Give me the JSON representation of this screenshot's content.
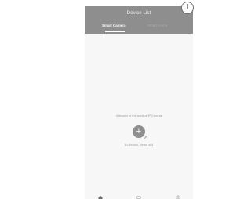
{
  "header": {
    "title": "Device List",
    "tabs": [
      {
        "label": "Smart Camera",
        "active": true
      },
      {
        "label": "Smart Home",
        "active": false
      }
    ]
  },
  "main": {
    "welcome_text": "Welcome to the world of IP Camera",
    "add_icon": "plus-icon",
    "empty_text": "No devices, please add"
  },
  "bottom_nav": {
    "icons": [
      "home-icon",
      "message-icon",
      "profile-icon"
    ]
  },
  "badge": {
    "label": "1"
  },
  "colors": {
    "header_bg": "#8e8e8e",
    "page_bg": "#f7f7f7",
    "add_button": "#8f8f8f"
  }
}
